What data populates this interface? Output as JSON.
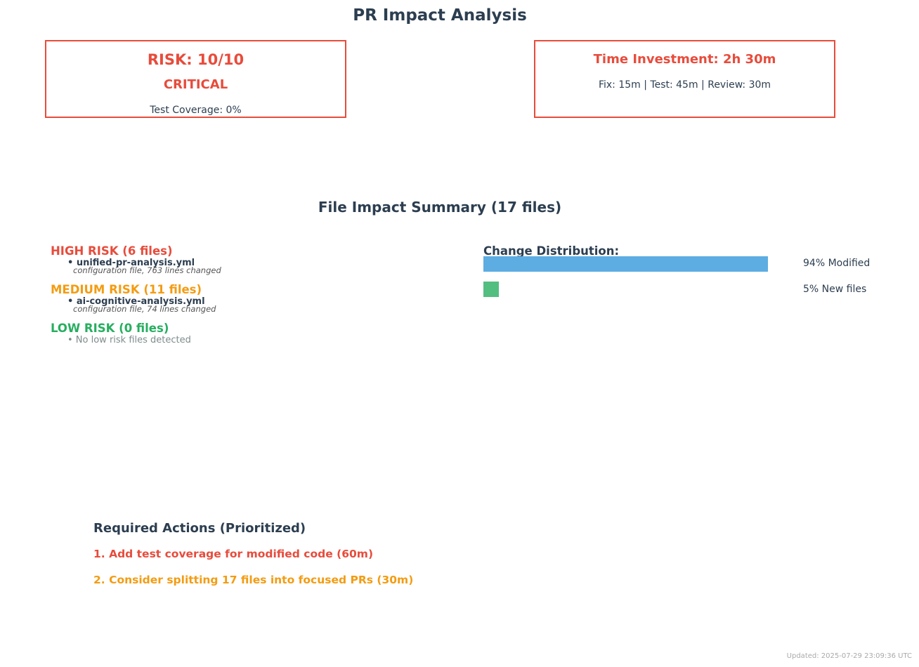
{
  "page": {
    "title": "PR Impact Analysis",
    "updated": "Updated: 2025-07-29 23:09:36 UTC"
  },
  "risk_card": {
    "score": "RISK: 10/10",
    "level": "CRITICAL",
    "coverage": "Test Coverage: 0%"
  },
  "time_card": {
    "title": "Time Investment: 2h 30m",
    "breakdown": "Fix: 15m | Test: 45m | Review: 30m"
  },
  "file_summary": {
    "title": "File Impact Summary (17 files)",
    "groups": [
      {
        "title": "HIGH RISK (6 files)",
        "color": "#e74c3c",
        "file_name": "• unified-pr-analysis.yml",
        "file_detail": "configuration file, 763 lines changed"
      },
      {
        "title": "MEDIUM RISK (11 files)",
        "color": "#f39c12",
        "file_name": "• ai-cognitive-analysis.yml",
        "file_detail": "configuration file, 74 lines changed"
      },
      {
        "title": "LOW RISK (0 files)",
        "color": "#27ae60",
        "empty_note": "• No low risk files detected"
      }
    ]
  },
  "chart_data": {
    "type": "bar",
    "orientation": "horizontal",
    "title": "Change Distribution:",
    "categories": [
      "Modified",
      "New files"
    ],
    "values": [
      94,
      5
    ],
    "labels": [
      "94% Modified",
      "5% New files"
    ],
    "colors": [
      "#5dade2",
      "#52be80"
    ],
    "xlim": [
      0,
      100
    ],
    "grid": false
  },
  "actions": {
    "title": "Required Actions (Prioritized)",
    "items": [
      {
        "text": "1. Add test coverage for modified code (60m)",
        "color": "#e74c3c"
      },
      {
        "text": "2. Consider splitting 17 files into focused PRs (30m)",
        "color": "#f39c12"
      }
    ]
  }
}
